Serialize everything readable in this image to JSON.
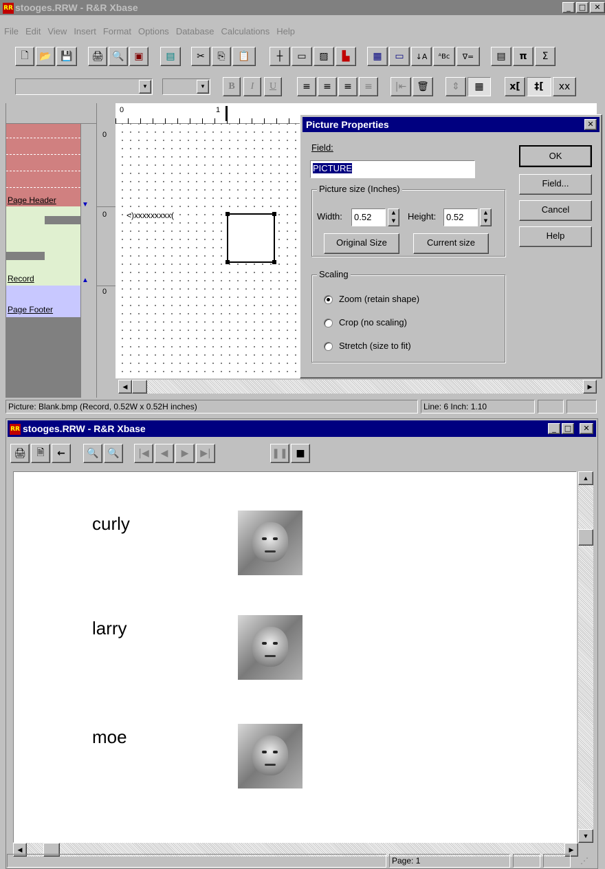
{
  "designer": {
    "title": "stooges.RRW - R&R Xbase",
    "menu": [
      "File",
      "Edit",
      "View",
      "Insert",
      "Format",
      "Options",
      "Database",
      "Calculations",
      "Help"
    ],
    "toolbar_icons": [
      "new-doc-icon",
      "open-folder-icon",
      "save-icon",
      "print-icon",
      "preview-icon",
      "picture-icon",
      "image-icon",
      "cut-icon",
      "copy-icon",
      "paste-icon",
      "line-icon",
      "box-icon",
      "picture-field-icon",
      "chart-icon",
      "table-icon",
      "field-icon",
      "sort-icon",
      "abc-icon",
      "filter-icon",
      "calculator-icon",
      "pi-icon",
      "sigma-icon"
    ],
    "format_buttons": {
      "bold": "B",
      "italic": "I",
      "underline": "U",
      "xl": "x[",
      "tl": "‡[",
      "xx": "xx"
    },
    "bands": {
      "header": "Page Header",
      "record": "Record",
      "footer": "Page Footer"
    },
    "ruler_marks": [
      "0",
      "1"
    ],
    "band_zero": "0",
    "field_placeholder": "<)xxxxxxxxx(",
    "status": {
      "info": "Picture: Blank.bmp  (Record, 0.52W x 0.52H inches)",
      "line": "Line:  6  Inch: 1.10"
    }
  },
  "dialog": {
    "title": "Picture Properties",
    "field_label": "Field:",
    "field_value": "PICTURE",
    "size_group": "Picture size (Inches)",
    "width_label": "Width:",
    "width_value": "0.52",
    "height_label": "Height:",
    "height_value": "0.52",
    "original_size": "Original Size",
    "current_size": "Current size",
    "scaling_group": "Scaling",
    "scaling_options": [
      "Zoom (retain shape)",
      "Crop (no scaling)",
      "Stretch (size to fit)"
    ],
    "scaling_selected": "Zoom (retain shape)",
    "ok": "OK",
    "field_btn": "Field...",
    "cancel": "Cancel",
    "help": "Help"
  },
  "preview": {
    "title": "stooges.RRW - R&R Xbase",
    "records": [
      {
        "name": "curly"
      },
      {
        "name": "larry"
      },
      {
        "name": "moe"
      }
    ],
    "status_page": "Page:  1"
  }
}
